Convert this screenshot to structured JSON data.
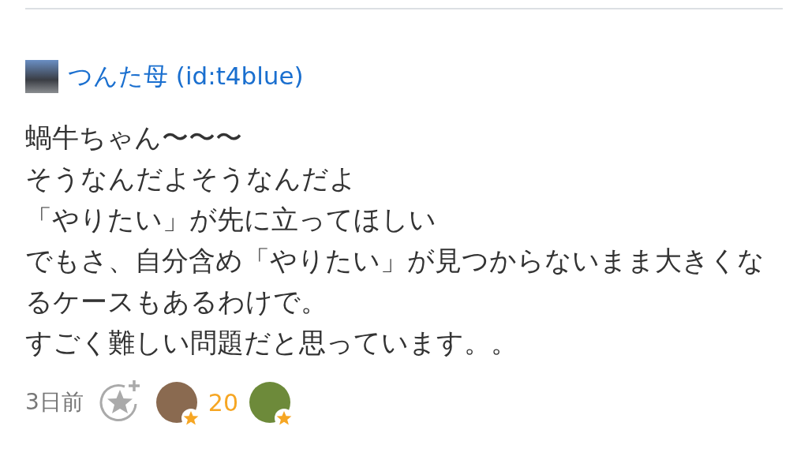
{
  "comment": {
    "author": "つんた母 (id:t4blue)",
    "lines": [
      "蝸牛ちゃん〜〜〜",
      "そうなんだよそうなんだよ",
      "「やりたい」が先に立ってほしい",
      "でもさ、自分含め「やりたい」が見つからないまま大きくなるケースもあるわけで。",
      "すごく難しい問題だと思っています。。"
    ],
    "time": "3日前",
    "stars": [
      {
        "color": "#f6a623",
        "count": "20"
      },
      {
        "color": "#f6a623"
      }
    ]
  }
}
